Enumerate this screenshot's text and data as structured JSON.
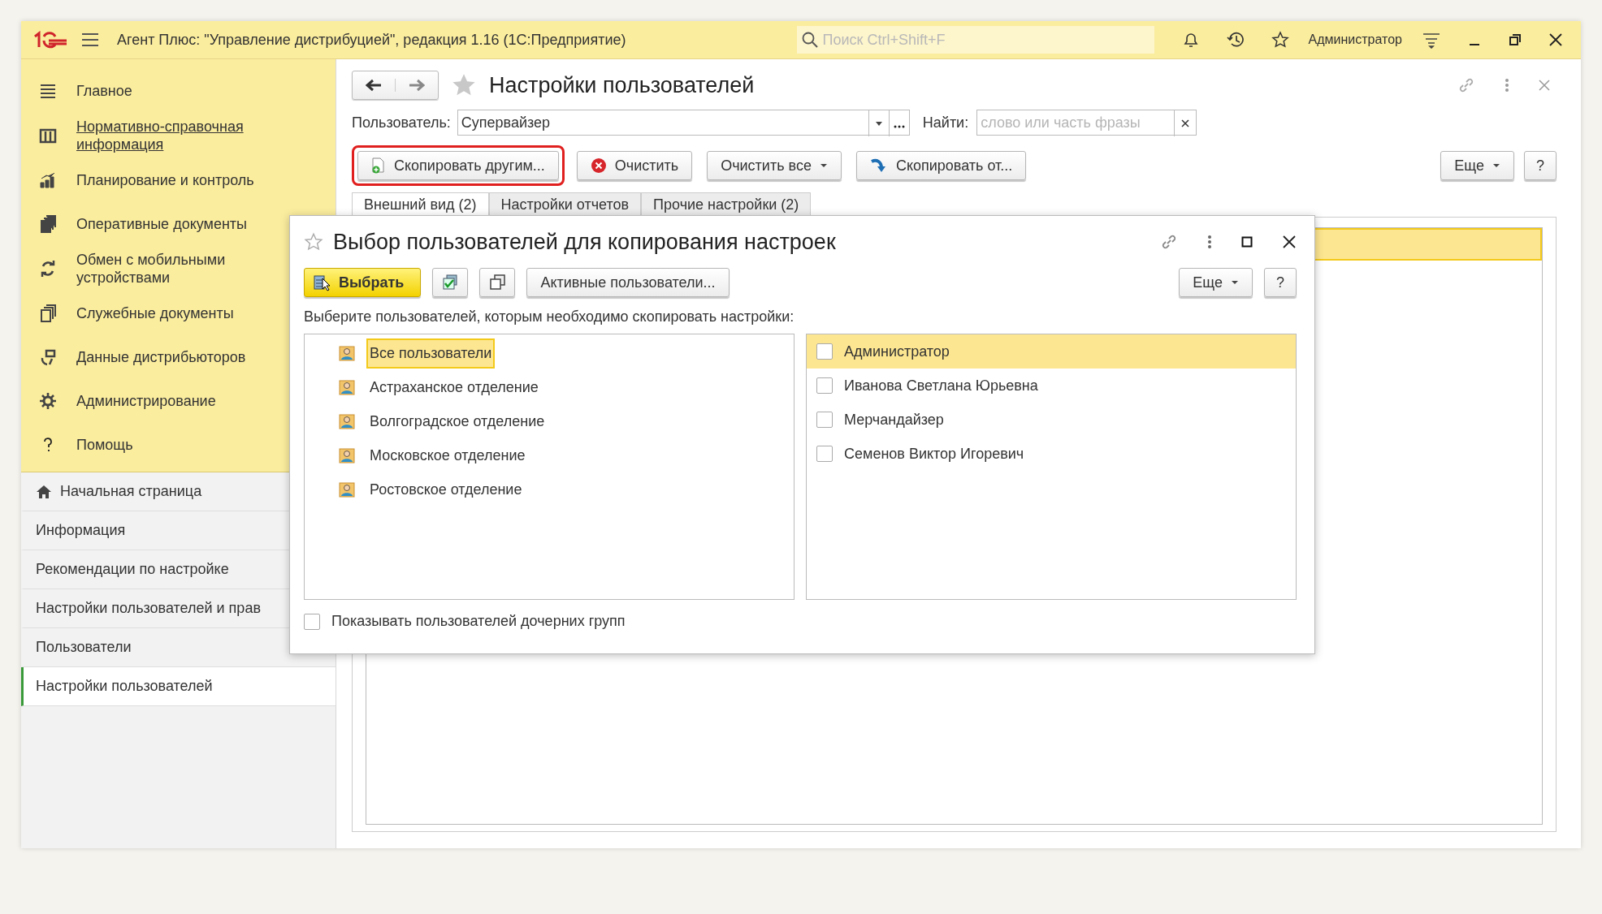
{
  "app_bar": {
    "title": "Агент Плюс: \"Управление дистрибуцией\", редакция 1.16  (1С:Предприятие)",
    "search": {
      "placeholder": "Поиск Ctrl+Shift+F"
    },
    "user": "Администратор"
  },
  "sidebar": {
    "sections": [
      {
        "label": "Главное",
        "underlined": false
      },
      {
        "label": "Нормативно-справочная информация",
        "underlined": true
      },
      {
        "label": "Планирование и контроль",
        "underlined": false
      },
      {
        "label": "Оперативные документы",
        "underlined": false
      },
      {
        "label": "Обмен с мобильными устройствами",
        "underlined": false
      },
      {
        "label": "Служебные документы",
        "underlined": false
      },
      {
        "label": "Данные дистрибьюторов",
        "underlined": false
      },
      {
        "label": "Администрирование",
        "underlined": false
      },
      {
        "label": "Помощь",
        "underlined": false
      }
    ],
    "open_windows": [
      {
        "label": "Начальная страница",
        "kind": "home",
        "selected": false
      },
      {
        "label": "Информация",
        "kind": "page",
        "selected": false
      },
      {
        "label": "Рекомендации по настройке",
        "kind": "page",
        "selected": false
      },
      {
        "label": "Настройки пользователей и прав",
        "kind": "page",
        "selected": false
      },
      {
        "label": "Пользователи",
        "kind": "page",
        "selected": false
      },
      {
        "label": "Настройки пользователей",
        "kind": "page",
        "selected": true
      }
    ]
  },
  "form": {
    "title": "Настройки пользователей",
    "user_field": {
      "label": "Пользователь:",
      "value": "Супервайзер"
    },
    "find_field": {
      "label": "Найти:",
      "placeholder": "слово или часть фразы"
    },
    "buttons": [
      {
        "label": "Скопировать другим...",
        "kind": "copy-to",
        "dropdown": false,
        "highlighted": true
      },
      {
        "label": "Очистить",
        "kind": "clear",
        "dropdown": false,
        "highlighted": false
      },
      {
        "label": "Очистить все",
        "kind": "plain",
        "dropdown": true,
        "highlighted": false
      },
      {
        "label": "Скопировать от...",
        "kind": "copy-from",
        "dropdown": false,
        "highlighted": false
      }
    ],
    "more_button": "Еще",
    "help_button": "?",
    "tabs": [
      {
        "label": "Внешний вид (2)",
        "selected": true
      },
      {
        "label": "Настройки отчетов",
        "selected": false
      },
      {
        "label": "Прочие настройки (2)",
        "selected": false
      }
    ]
  },
  "dialog": {
    "title": "Выбор пользователей для копирования настроек",
    "select_button": "Выбрать",
    "active_users_button": "Активные пользователи...",
    "more_button": "Еще",
    "help_button": "?",
    "instruction": "Выберите пользователей, которым необходимо скопировать настройки:",
    "groups": [
      {
        "label": "Все пользователи",
        "selected": true
      },
      {
        "label": "Астраханское отделение",
        "selected": false
      },
      {
        "label": "Волгоградское отделение",
        "selected": false
      },
      {
        "label": "Московское отделение",
        "selected": false
      },
      {
        "label": "Ростовское отделение",
        "selected": false
      }
    ],
    "users": [
      {
        "name": "Администратор",
        "checked": false,
        "selected": true
      },
      {
        "name": "Иванова Светлана Юрьевна",
        "checked": false,
        "selected": false
      },
      {
        "name": "Мерчандайзер",
        "checked": false,
        "selected": false
      },
      {
        "name": "Семенов Виктор Игоревич",
        "checked": false,
        "selected": false
      }
    ],
    "show_subgroups": {
      "label": "Показывать пользователей дочерних групп",
      "checked": false
    }
  }
}
